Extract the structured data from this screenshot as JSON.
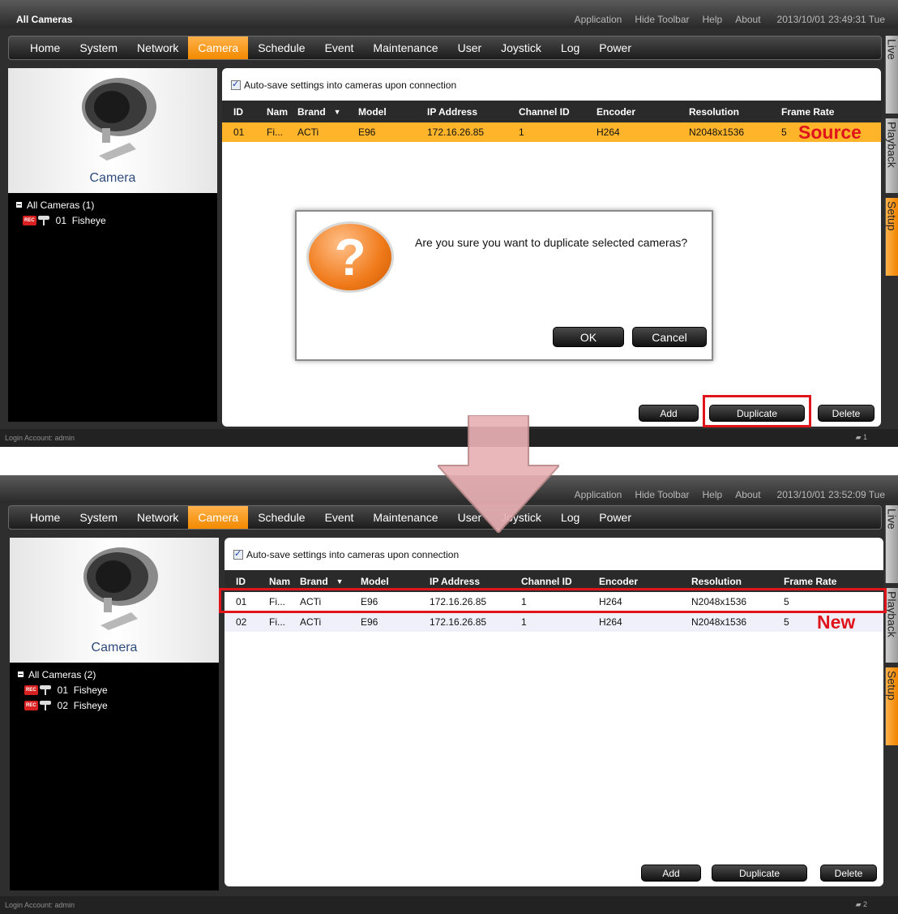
{
  "colors": {
    "accent": "#f59a12",
    "annotation": "#e0141b",
    "selected_row": "#ffb42a"
  },
  "screen1": {
    "app_title": "All Cameras",
    "top_menu": [
      "Application",
      "Hide Toolbar",
      "Help",
      "About"
    ],
    "clock": "2013/10/01 23:49:31 Tue",
    "nav": [
      "Home",
      "System",
      "Network",
      "Camera",
      "Schedule",
      "Event",
      "Maintenance",
      "User",
      "Joystick",
      "Log",
      "Power"
    ],
    "active_nav": "Camera",
    "side_tabs": [
      "Live",
      "Playback",
      "Setup"
    ],
    "camera_label": "Camera",
    "tree_root": "All Cameras (1)",
    "tree_items": [
      "01  Fisheye"
    ],
    "autosave_label": "Auto-save settings into cameras upon connection",
    "columns": [
      "ID",
      "Nam",
      "Brand",
      "Model",
      "IP Address",
      "Channel ID",
      "Encoder",
      "Resolution",
      "Frame Rate"
    ],
    "rows": [
      [
        "01",
        "Fi...",
        "ACTi",
        "E96",
        "172.16.26.85",
        "1",
        "H264",
        "N2048x1536",
        "5"
      ]
    ],
    "annotation": "Source",
    "dialog": {
      "message": "Are you sure you want to duplicate selected cameras?",
      "icon": "question-icon",
      "icon_text": "?",
      "ok": "OK",
      "cancel": "Cancel"
    },
    "buttons": {
      "add": "Add",
      "duplicate": "Duplicate",
      "delete": "Delete"
    },
    "login": "Login Account: admin",
    "count": "1"
  },
  "screen2": {
    "top_menu": [
      "Application",
      "Hide Toolbar",
      "Help",
      "About"
    ],
    "clock": "2013/10/01 23:52:09 Tue",
    "nav": [
      "Home",
      "System",
      "Network",
      "Camera",
      "Schedule",
      "Event",
      "Maintenance",
      "User",
      "Joystick",
      "Log",
      "Power"
    ],
    "active_nav": "Camera",
    "side_tabs": [
      "Live",
      "Playback",
      "Setup"
    ],
    "camera_label": "Camera",
    "tree_root": "All Cameras (2)",
    "tree_items": [
      "01  Fisheye",
      "02  Fisheye"
    ],
    "autosave_label": "Auto-save settings into cameras upon connection",
    "columns": [
      "ID",
      "Nam",
      "Brand",
      "Model",
      "IP Address",
      "Channel ID",
      "Encoder",
      "Resolution",
      "Frame Rate"
    ],
    "rows": [
      [
        "01",
        "Fi...",
        "ACTi",
        "E96",
        "172.16.26.85",
        "1",
        "H264",
        "N2048x1536",
        "5"
      ],
      [
        "02",
        "Fi...",
        "ACTi",
        "E96",
        "172.16.26.85",
        "1",
        "H264",
        "N2048x1536",
        "5"
      ]
    ],
    "annotation": "New",
    "buttons": {
      "add": "Add",
      "duplicate": "Duplicate",
      "delete": "Delete"
    },
    "login": "Login Account: admin",
    "count": "2"
  }
}
